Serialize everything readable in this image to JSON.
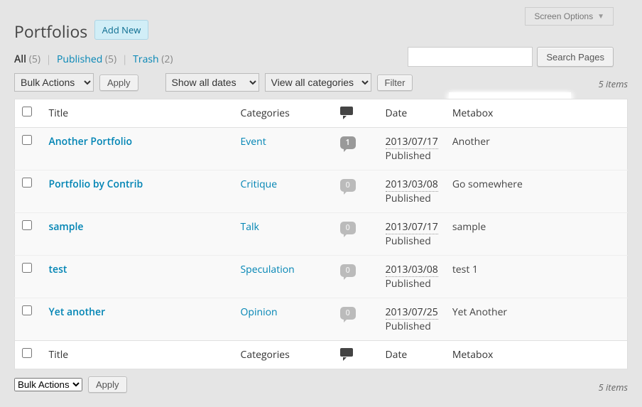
{
  "screen_options_label": "Screen Options",
  "heading": "Portfolios",
  "add_new_label": "Add New",
  "filters": {
    "all_label": "All",
    "all_count": "(5)",
    "published_label": "Published",
    "published_count": "(5)",
    "trash_label": "Trash",
    "trash_count": "(2)"
  },
  "search": {
    "button": "Search Pages"
  },
  "bulk_select": "Bulk Actions",
  "apply_label": "Apply",
  "dates_select": "Show all dates",
  "cats_select": "View all categories",
  "filter_label": "Filter",
  "items_count": "5 items",
  "columns": {
    "title": "Title",
    "categories": "Categories",
    "date": "Date",
    "metabox": "Metabox"
  },
  "rows": [
    {
      "title": "Another Portfolio",
      "category": "Event",
      "comments": "1",
      "zero": false,
      "date": "2013/07/17",
      "status": "Published",
      "metabox": "Another"
    },
    {
      "title": "Portfolio by Contrib",
      "category": "Critique",
      "comments": "0",
      "zero": true,
      "date": "2013/03/08",
      "status": "Published",
      "metabox": "Go somewhere"
    },
    {
      "title": "sample",
      "category": "Talk",
      "comments": "0",
      "zero": true,
      "date": "2013/07/17",
      "status": "Published",
      "metabox": "sample"
    },
    {
      "title": "test",
      "category": "Speculation",
      "comments": "0",
      "zero": true,
      "date": "2013/03/08",
      "status": "Published",
      "metabox": "test 1"
    },
    {
      "title": "Yet another",
      "category": "Opinion",
      "comments": "0",
      "zero": true,
      "date": "2013/07/25",
      "status": "Published",
      "metabox": "Yet Another"
    }
  ]
}
